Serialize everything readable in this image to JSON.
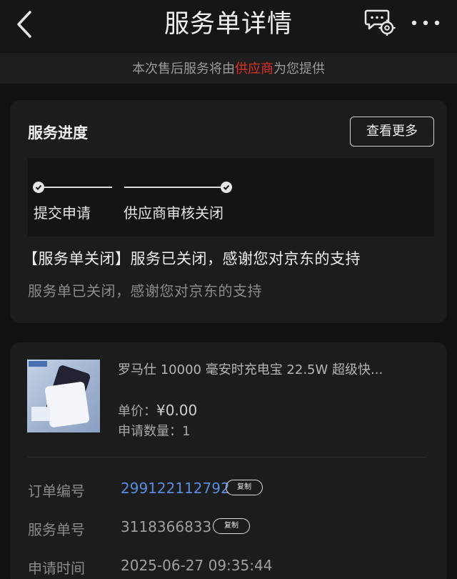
{
  "header": {
    "title": "服务单详情",
    "icons": [
      "back-arrow-icon",
      "chat-settings-icon",
      "more-icon"
    ]
  },
  "notice": {
    "prefix": "本次售后服务将由",
    "highlight": "供应商",
    "suffix": "为您提供",
    "highlight_color": "#e0312b"
  },
  "progress_card": {
    "title": "服务进度",
    "more_button": "查看更多",
    "steps": [
      {
        "label": "提交申请",
        "done": true
      },
      {
        "label": "供应商审核关闭",
        "done": true
      }
    ],
    "status_main": "【服务单关闭】服务已关闭，感谢您对京东的支持",
    "status_sub": "服务单已关闭，感谢您对京东的支持"
  },
  "product": {
    "name": "罗马仕 10000 毫安时充电宝 22.5W 超级快...",
    "price_label": "单价：",
    "price_value": "¥0.00",
    "qty_label": "申请数量：",
    "qty_value": "1"
  },
  "details": {
    "order_no_label": "订单编号",
    "order_no": "299122112792",
    "service_no_label": "服务单号",
    "service_no": "3118366833",
    "apply_time_label": "申请时间",
    "apply_time": "2025-06-27 09:35:44",
    "copy_label": "复制",
    "link_color": "#5a8cde"
  }
}
